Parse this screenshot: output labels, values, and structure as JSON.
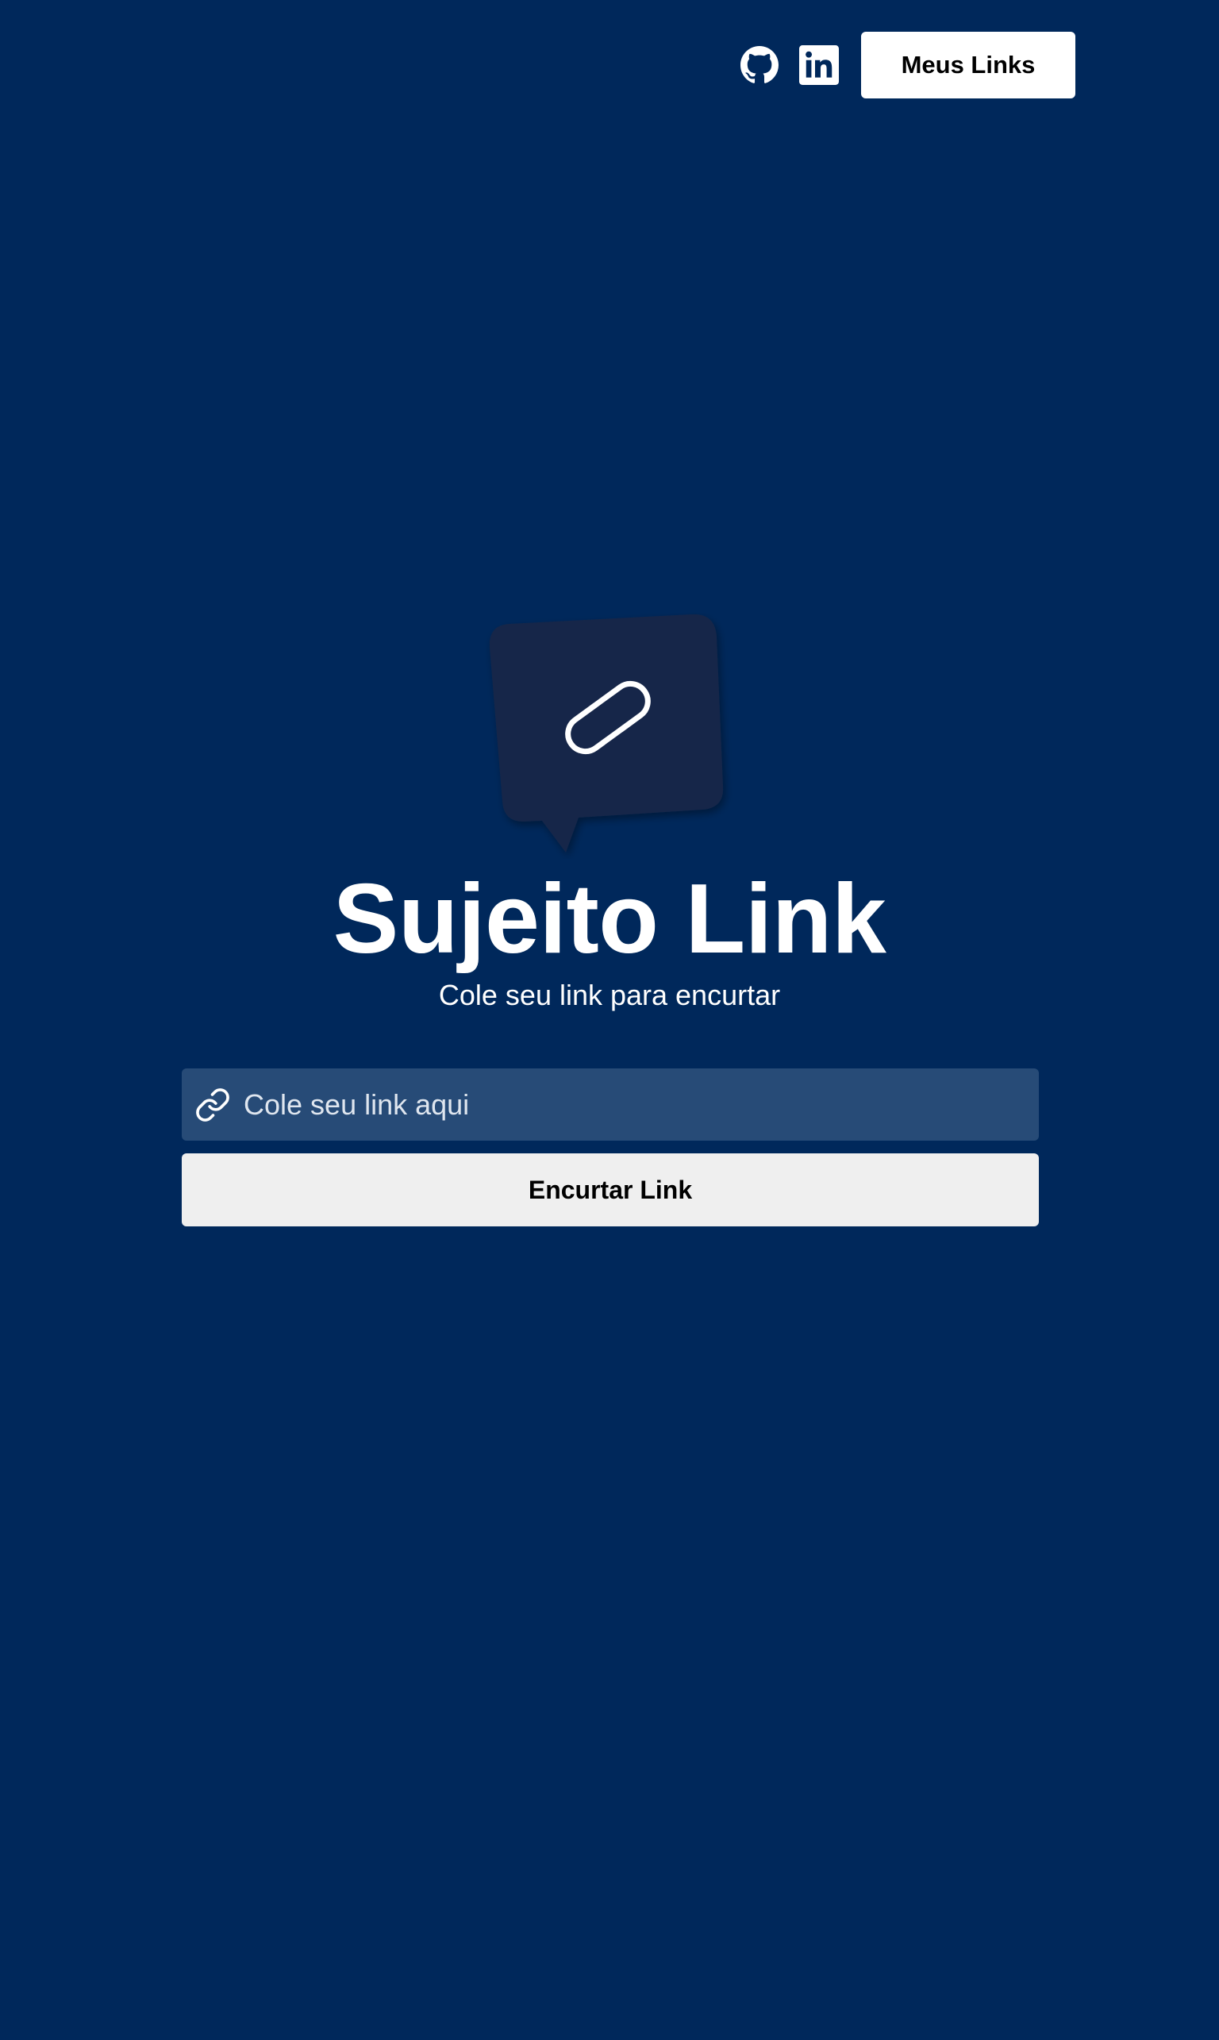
{
  "header": {
    "github_icon": "github-icon",
    "linkedin_icon": "linkedin-icon",
    "my_links_label": "Meus Links"
  },
  "hero": {
    "logo_icon": "chat-link-logo",
    "title": "Sujeito Link",
    "subtitle": "Cole seu link para encurtar"
  },
  "form": {
    "input_icon": "link-icon",
    "input_placeholder": "Cole seu link aqui",
    "input_value": "",
    "submit_label": "Encurtar Link"
  },
  "colors": {
    "background": "#00285b",
    "logo_bubble": "#15284a",
    "input_background": "#274b77",
    "button_primary": "#efefef",
    "button_header": "#ffffff"
  }
}
